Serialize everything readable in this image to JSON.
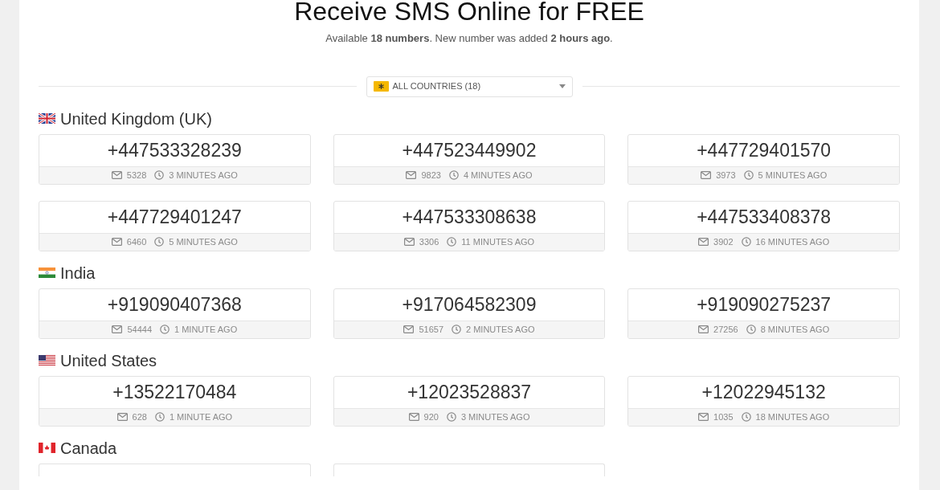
{
  "header": {
    "title": "Receive SMS Online for FREE",
    "subtitle": "Available **18 numbers**. New number was added **2 hours ago**."
  },
  "filter": {
    "label": "ALL COUNTRIES (18)"
  },
  "countries": [
    {
      "name": "United Kingdom (UK)",
      "flag": {
        "kind": "uk"
      },
      "numbers": [
        {
          "kind": "full",
          "number": "+447533328239",
          "messages": "5328",
          "time": "3 MINUTES AGO"
        },
        {
          "kind": "full",
          "number": "+447523449902",
          "messages": "9823",
          "time": "4 MINUTES AGO"
        },
        {
          "kind": "full",
          "number": "+447729401570",
          "messages": "3973",
          "time": "5 MINUTES AGO"
        },
        {
          "kind": "full",
          "number": "+447729401247",
          "messages": "6460",
          "time": "5 MINUTES AGO"
        },
        {
          "kind": "full",
          "number": "+447533308638",
          "messages": "3306",
          "time": "11 MINUTES AGO"
        },
        {
          "kind": "full",
          "number": "+447533408378",
          "messages": "3902",
          "time": "16 MINUTES AGO"
        }
      ]
    },
    {
      "name": "India",
      "flag": {
        "kind": "in"
      },
      "numbers": [
        {
          "kind": "full",
          "number": "+919090407368",
          "messages": "54444",
          "time": "1 MINUTE AGO"
        },
        {
          "kind": "full",
          "number": "+917064582309",
          "messages": "51657",
          "time": "2 MINUTES AGO"
        },
        {
          "kind": "full",
          "number": "+919090275237",
          "messages": "27256",
          "time": "8 MINUTES AGO"
        }
      ]
    },
    {
      "name": "United States",
      "flag": {
        "kind": "us"
      },
      "numbers": [
        {
          "kind": "full",
          "number": "+13522170484",
          "messages": "628",
          "time": "1 MINUTE AGO"
        },
        {
          "kind": "full",
          "number": "+12023528837",
          "messages": "920",
          "time": "3 MINUTES AGO"
        },
        {
          "kind": "full",
          "number": "+12022945132",
          "messages": "1035",
          "time": "18 MINUTES AGO"
        }
      ]
    },
    {
      "name": "Canada",
      "flag": {
        "kind": "ca"
      },
      "numbers": [
        {
          "kind": "cut"
        },
        {
          "kind": "cut"
        }
      ]
    }
  ]
}
